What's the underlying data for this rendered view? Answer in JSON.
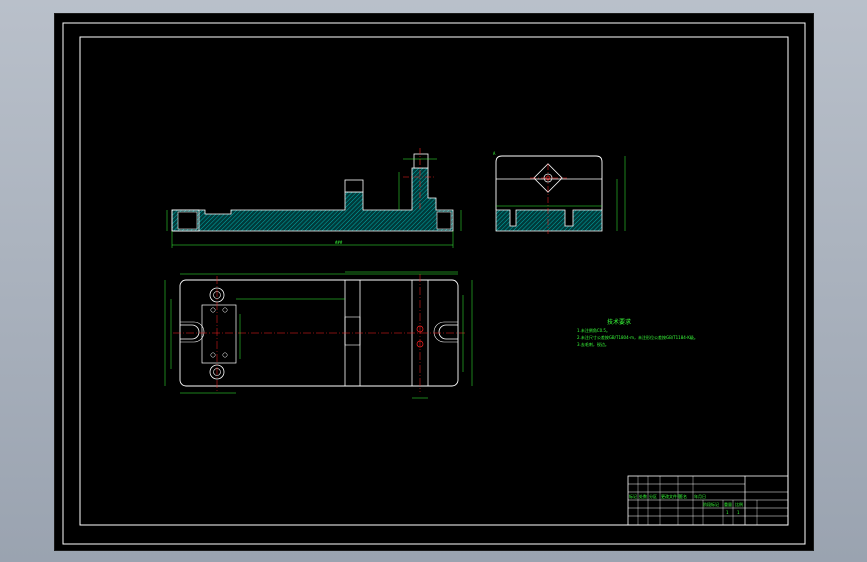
{
  "window": {
    "background_color": "#000000",
    "frame_color": "#ffffff",
    "dimension_color": "#39ff3a",
    "centerline_color": "#ff2020",
    "hatch_color": "#00c8c8"
  },
  "front_view": {
    "overall_length_label": "###"
  },
  "side_view": {
    "marker": "A"
  },
  "technical_requirements": {
    "title": "技术要求",
    "lines": [
      "1.未注倒角C0.5。",
      "2.未注尺寸公差按GB/T1804-m，未注形位公差按GB/T1184-K级。",
      "3.去毛刺，锐边。"
    ]
  },
  "title_block": {
    "row_labels": [
      "标记",
      "处数",
      "分区",
      "更改文件号",
      "签名",
      "年月日"
    ],
    "bottom_labels": [
      "阶段标记",
      "重量",
      "比例"
    ],
    "scale_values": [
      "1",
      "1"
    ]
  }
}
